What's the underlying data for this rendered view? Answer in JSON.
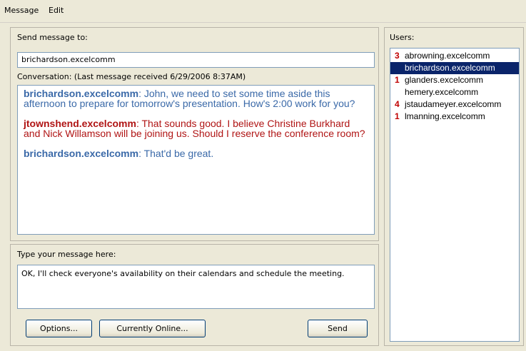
{
  "menu": {
    "items": [
      "Message",
      "Edit"
    ]
  },
  "send_to": {
    "label": "Send message to:",
    "value": "brichardson.excelcomm"
  },
  "conversation": {
    "label": "Conversation: (Last message received 6/29/2006 8:37AM)",
    "messages": [
      {
        "sender": "brichardson.excelcomm",
        "text": ": John, we need to set some time aside this afternoon to prepare for tomorrow's presentation. How's 2:00 work for you?",
        "color": "#3a69a8"
      },
      {
        "sender": "jtownshend.excelcomm",
        "text": ": That sounds good. I believe Christine Burkhard and Nick Willamson will be joining us. Should I reserve the conference room?",
        "color": "#b01414"
      },
      {
        "sender": "brichardson.excelcomm",
        "text": ": That'd be great.",
        "color": "#3a69a8"
      }
    ]
  },
  "compose": {
    "label": "Type your message here:",
    "value": "OK, I'll check everyone's availability on their calendars and schedule the meeting."
  },
  "buttons": {
    "options": "Options...",
    "currently_online": "Currently Online...",
    "send": "Send"
  },
  "users": {
    "label": "Users:",
    "items": [
      {
        "count": "3",
        "name": "abrowning.excelcomm",
        "selected": false
      },
      {
        "count": "",
        "name": "brichardson.excelcomm",
        "selected": true
      },
      {
        "count": "1",
        "name": "glanders.excelcomm",
        "selected": false
      },
      {
        "count": "",
        "name": "hemery.excelcomm",
        "selected": false
      },
      {
        "count": "4",
        "name": "jstaudameyer.excelcomm",
        "selected": false
      },
      {
        "count": "1",
        "name": "lmanning.excelcomm",
        "selected": false
      }
    ]
  },
  "colors": {
    "selection": "#0a246a",
    "unread_count": "#c00000",
    "window_bg": "#ece9d8"
  }
}
